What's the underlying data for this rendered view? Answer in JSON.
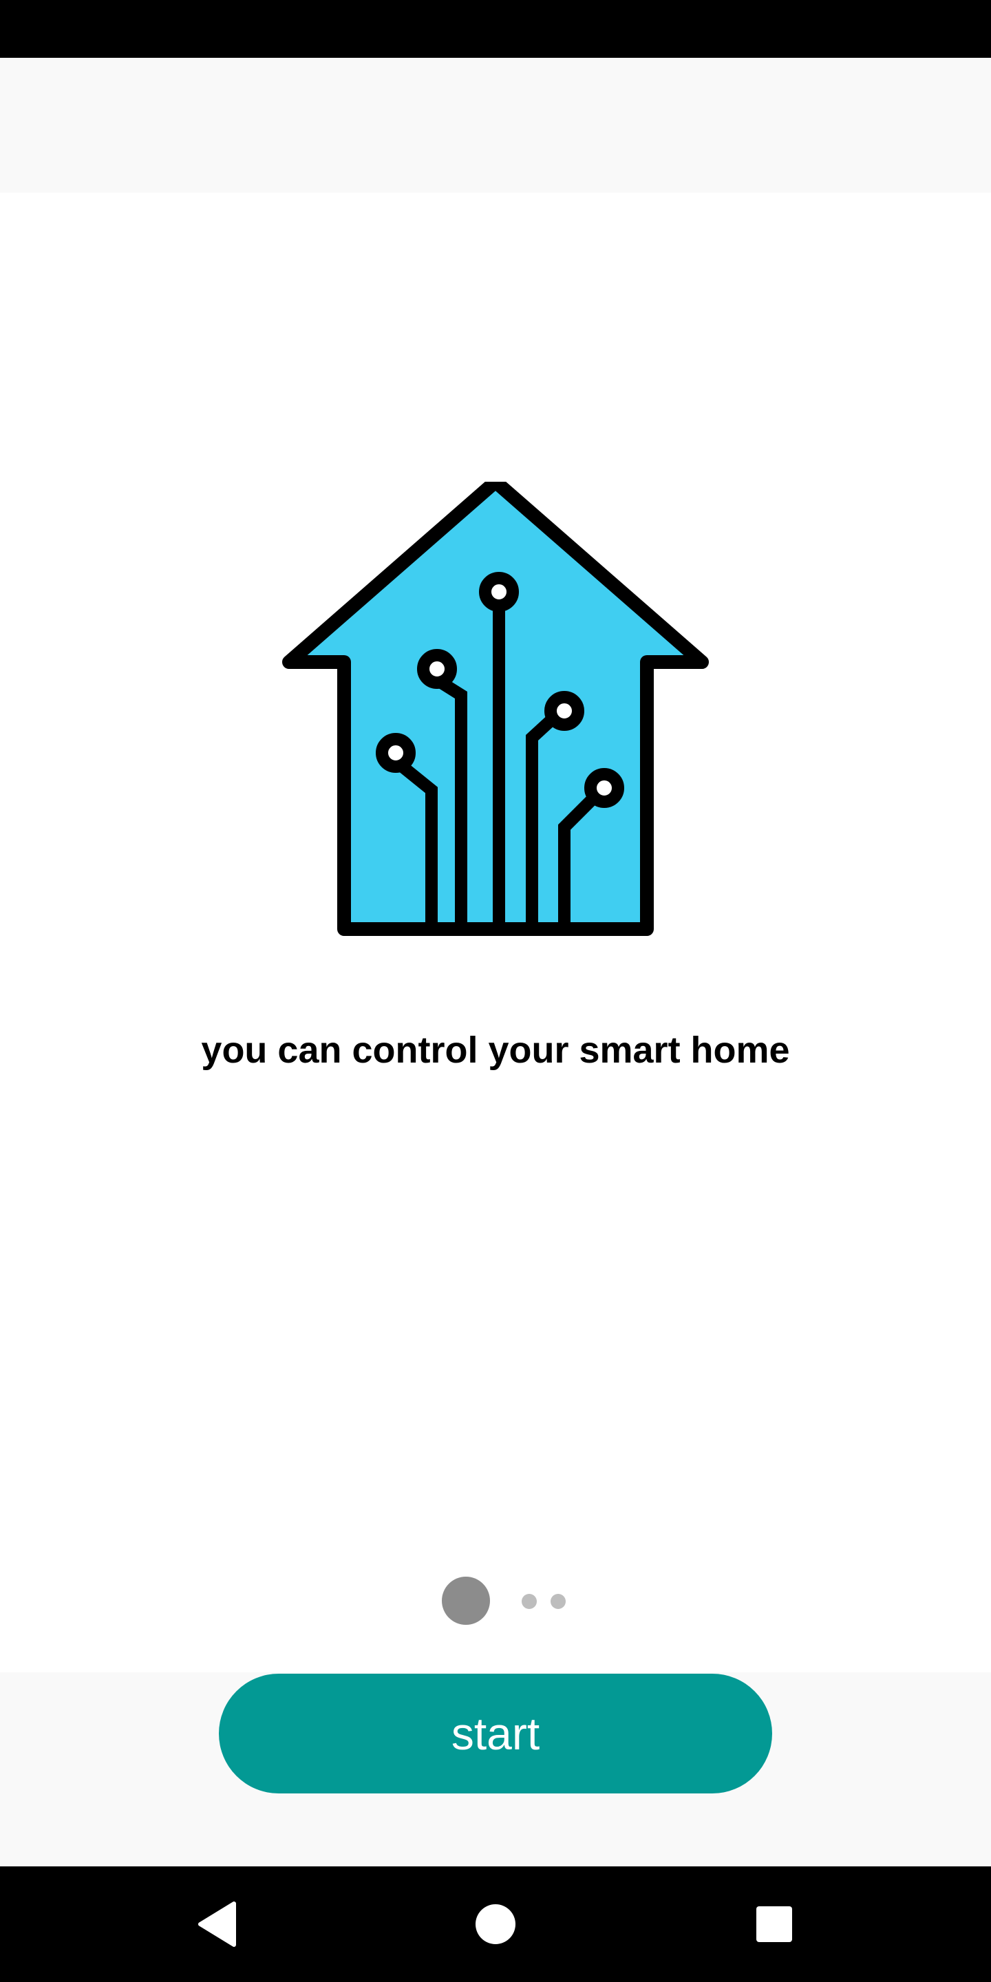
{
  "onboarding": {
    "caption": "you can control your smart home",
    "illustration_icon": "smart-home-circuit-icon",
    "page_indicator": {
      "total": 3,
      "current": 1
    },
    "start_label": "start"
  },
  "nav": {
    "back_icon": "back-triangle-icon",
    "home_icon": "home-circle-icon",
    "recent_icon": "recent-apps-square-icon"
  },
  "colors": {
    "accent": "#039994",
    "house_fill": "#40cef1",
    "outline": "#000000",
    "app_bar": "#f9f9f9",
    "dot_active": "#8c8c8c",
    "dot_inactive": "#bdbdbd"
  }
}
